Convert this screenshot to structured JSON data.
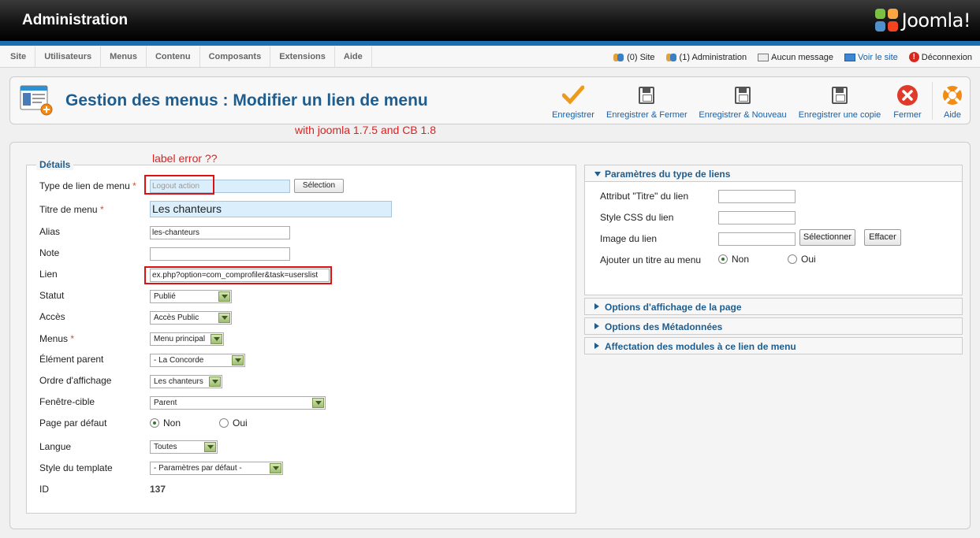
{
  "header": {
    "title": "Administration",
    "logo_text": "Joomla!"
  },
  "menubar": {
    "items": [
      "Site",
      "Utilisateurs",
      "Menus",
      "Contenu",
      "Composants",
      "Extensions",
      "Aide"
    ],
    "status": {
      "site": "(0) Site",
      "admin": "(1) Administration",
      "messages": "Aucun message",
      "view_site": "Voir le site",
      "logout": "Déconnexion"
    }
  },
  "toolbar": {
    "page_title": "Gestion des menus : Modifier un lien de menu",
    "buttons": {
      "save": "Enregistrer",
      "save_close": "Enregistrer & Fermer",
      "save_new": "Enregistrer & Nouveau",
      "save_copy": "Enregistrer une copie",
      "close": "Fermer",
      "help": "Aide"
    }
  },
  "annotations": {
    "version_note": "with joomla 1.7.5 and CB 1.8",
    "label_error": "label error ??"
  },
  "details": {
    "legend": "Détails",
    "labels": {
      "type": "Type de lien de menu",
      "title": "Titre de menu",
      "alias": "Alias",
      "note": "Note",
      "link": "Lien",
      "status": "Statut",
      "access": "Accès",
      "menus": "Menus",
      "parent": "Élément parent",
      "order": "Ordre d'affichage",
      "target": "Fenêtre-cible",
      "default_page": "Page par défaut",
      "language": "Langue",
      "template_style": "Style du template",
      "id": "ID"
    },
    "required_mark": "*",
    "values": {
      "type": "Logout action",
      "select_button": "Sélection",
      "title": "Les chanteurs",
      "alias": "les-chanteurs",
      "note": "",
      "link": "ex.php?option=com_comprofiler&task=userslist",
      "status": "Publié",
      "access": "Accès Public",
      "menus": "Menu principal",
      "parent": "- La Concorde",
      "order": "Les chanteurs",
      "target": "Parent",
      "default_no": "Non",
      "default_yes": "Oui",
      "default_selected": "Non",
      "language": "Toutes",
      "template_style": "- Paramètres par défaut -",
      "id": "137"
    }
  },
  "params": {
    "title": "Paramètres du type de liens",
    "labels": {
      "title_attr": "Attribut \"Titre\" du lien",
      "css": "Style CSS du lien",
      "image": "Image du lien",
      "add_title": "Ajouter un titre au menu"
    },
    "select_button": "Sélectionner",
    "clear_button": "Effacer",
    "radio_no": "Non",
    "radio_yes": "Oui",
    "radio_selected": "Non"
  },
  "sections": {
    "page_display": "Options d'affichage de la page",
    "metadata": "Options des Métadonnées",
    "modules": "Affectation des modules à ce lien de menu"
  }
}
